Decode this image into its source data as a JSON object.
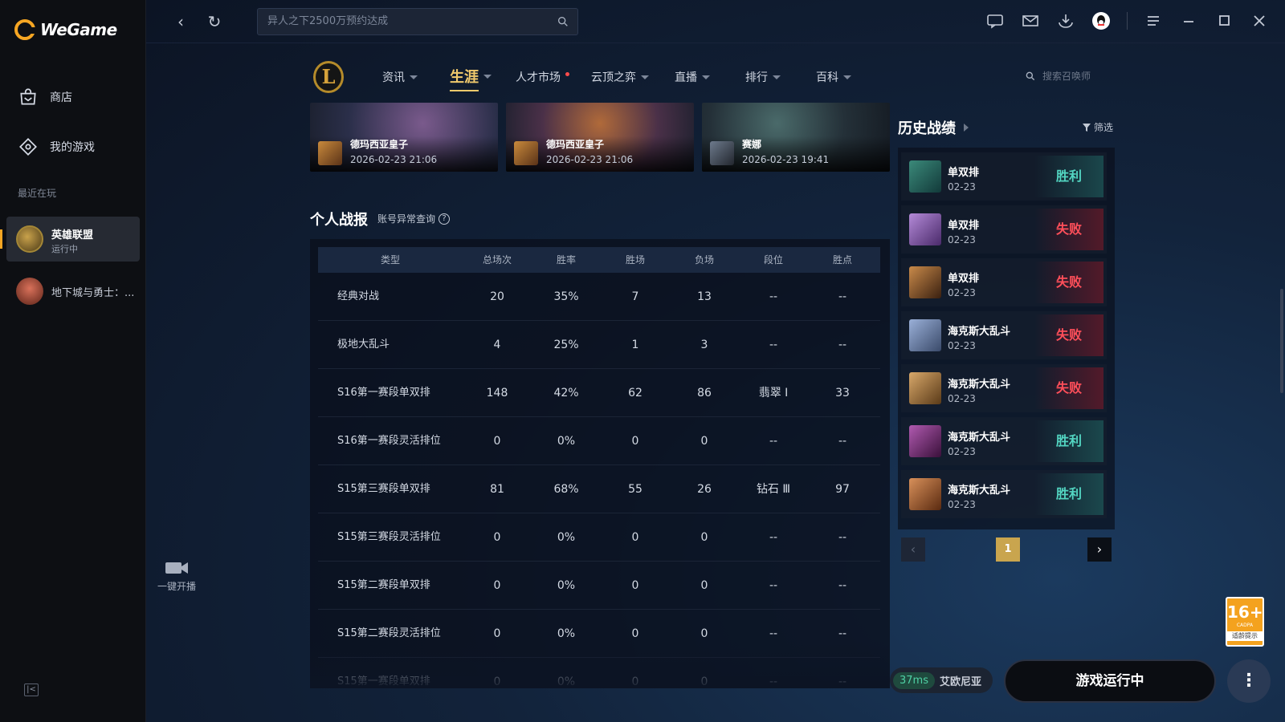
{
  "app": {
    "logo_text": "WeGame",
    "colors": {
      "accent": "#f6a623",
      "win": "#53d6c2",
      "lose": "#ff4f5a",
      "gold": "#f0c96c"
    }
  },
  "sidebar": {
    "items": [
      {
        "label": "商店",
        "icon": "shop-bag-icon"
      },
      {
        "label": "我的游戏",
        "icon": "gamepad-icon"
      }
    ],
    "recent_label": "最近在玩",
    "recent": [
      {
        "name": "英雄联盟",
        "status": "运行中"
      },
      {
        "name": "地下城与勇士：..."
      }
    ],
    "live_label": "一键开播"
  },
  "topbar": {
    "search_value": "异人之下2500万预约达成",
    "icons": [
      "chat-icon",
      "mail-icon",
      "download-icon",
      "qq-avatar-icon",
      "menu-icon",
      "minimize-icon",
      "maximize-icon",
      "close-icon"
    ]
  },
  "game_nav": {
    "logo_letter": "L",
    "items": [
      {
        "label": "资讯",
        "caret": true
      },
      {
        "label": "生涯",
        "caret": true,
        "active": true
      },
      {
        "label": "人才市场",
        "dot": true
      },
      {
        "label": "云顶之弈",
        "caret": true
      },
      {
        "label": "直播",
        "caret": true
      },
      {
        "label": "排行",
        "caret": true
      },
      {
        "label": "百科",
        "caret": true
      }
    ],
    "summoner_search_placeholder": "搜索召唤师"
  },
  "videos": [
    {
      "name": "德玛西亚皇子",
      "time": "2026-02-23 21:06"
    },
    {
      "name": "德玛西亚皇子",
      "time": "2026-02-23 21:06"
    },
    {
      "name": "赛娜",
      "time": "2026-02-23 19:41"
    }
  ],
  "record": {
    "title": "个人战报",
    "link": "账号异常查询",
    "headers": [
      "类型",
      "总场次",
      "胜率",
      "胜场",
      "负场",
      "段位",
      "胜点"
    ],
    "rows": [
      [
        "经典对战",
        "20",
        "35%",
        "7",
        "13",
        "--",
        "--"
      ],
      [
        "极地大乱斗",
        "4",
        "25%",
        "1",
        "3",
        "--",
        "--"
      ],
      [
        "S16第一赛段单双排",
        "148",
        "42%",
        "62",
        "86",
        "翡翠 Ⅰ",
        "33"
      ],
      [
        "S16第一赛段灵活排位",
        "0",
        "0%",
        "0",
        "0",
        "--",
        "--"
      ],
      [
        "S15第三赛段单双排",
        "81",
        "68%",
        "55",
        "26",
        "钻石 Ⅲ",
        "97"
      ],
      [
        "S15第三赛段灵活排位",
        "0",
        "0%",
        "0",
        "0",
        "--",
        "--"
      ],
      [
        "S15第二赛段单双排",
        "0",
        "0%",
        "0",
        "0",
        "--",
        "--"
      ],
      [
        "S15第二赛段灵活排位",
        "0",
        "0%",
        "0",
        "0",
        "--",
        "--"
      ],
      [
        "S15第一赛段单双排",
        "0",
        "0%",
        "0",
        "0",
        "--",
        "--"
      ]
    ]
  },
  "history": {
    "title": "历史战绩",
    "filter": "筛选",
    "matches": [
      {
        "mode": "单双排",
        "date": "02-23",
        "result": "胜利",
        "win": true
      },
      {
        "mode": "单双排",
        "date": "02-23",
        "result": "失败",
        "win": false
      },
      {
        "mode": "单双排",
        "date": "02-23",
        "result": "失败",
        "win": false
      },
      {
        "mode": "海克斯大乱斗",
        "date": "02-23",
        "result": "失败",
        "win": false
      },
      {
        "mode": "海克斯大乱斗",
        "date": "02-23",
        "result": "失败",
        "win": false
      },
      {
        "mode": "海克斯大乱斗",
        "date": "02-23",
        "result": "胜利",
        "win": true
      },
      {
        "mode": "海克斯大乱斗",
        "date": "02-23",
        "result": "胜利",
        "win": true
      }
    ],
    "page": "1"
  },
  "status": {
    "ping": "37ms",
    "server": "艾欧尼亚",
    "run_label": "游戏运行中",
    "more": "⋮"
  },
  "age_badge": {
    "num": "16+",
    "sub": "CADPA",
    "tip": "适龄提示"
  }
}
